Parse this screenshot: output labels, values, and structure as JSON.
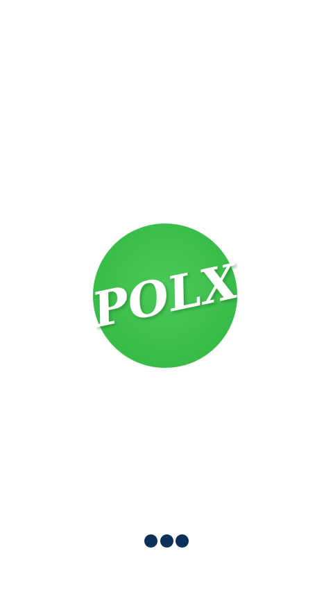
{
  "splash": {
    "logo_text": "POLX",
    "logo_color": "#3bbd4b",
    "background_color": "#ffffff"
  },
  "loader": {
    "dot_count": 3,
    "dot_color": "#0b3158"
  }
}
